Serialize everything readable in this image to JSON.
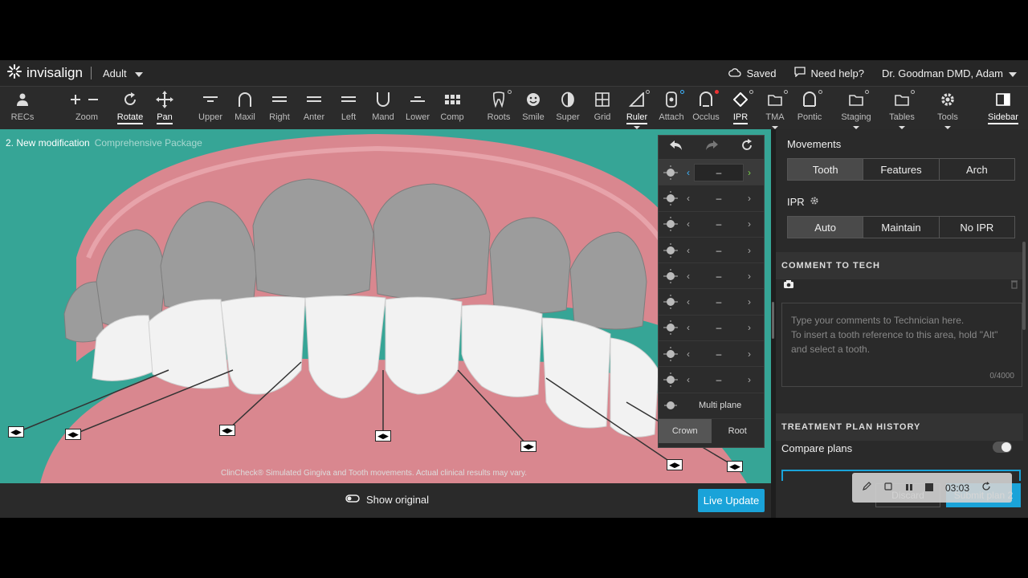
{
  "header": {
    "brand": "invisalign",
    "patient_type": "Adult",
    "saved_label": "Saved",
    "help_label": "Need help?",
    "user": "Dr. Goodman DMD, Adam"
  },
  "toolbar": [
    {
      "label": "RECs",
      "icon": "person-icon"
    },
    {
      "label": "Zoom",
      "icon": "zoom-icon"
    },
    {
      "label": "Rotate",
      "icon": "rotate-icon"
    },
    {
      "label": "Pan",
      "icon": "pan-icon"
    },
    {
      "label": "Upper",
      "icon": "upper-icon"
    },
    {
      "label": "Maxil",
      "icon": "maxil-icon"
    },
    {
      "label": "Right",
      "icon": "right-view-icon"
    },
    {
      "label": "Anter",
      "icon": "anterior-icon"
    },
    {
      "label": "Left",
      "icon": "left-view-icon"
    },
    {
      "label": "Mand",
      "icon": "mand-icon"
    },
    {
      "label": "Lower",
      "icon": "lower-icon"
    },
    {
      "label": "Comp",
      "icon": "comp-icon"
    },
    {
      "label": "Roots",
      "icon": "roots-icon"
    },
    {
      "label": "Smile",
      "icon": "smile-icon"
    },
    {
      "label": "Super",
      "icon": "super-icon"
    },
    {
      "label": "Grid",
      "icon": "grid-icon"
    },
    {
      "label": "Ruler",
      "icon": "ruler-icon"
    },
    {
      "label": "Attach",
      "icon": "attach-icon"
    },
    {
      "label": "Occlus",
      "icon": "occlusion-icon"
    },
    {
      "label": "IPR",
      "icon": "ipr-icon"
    },
    {
      "label": "TMA",
      "icon": "tma-icon"
    },
    {
      "label": "Pontic",
      "icon": "pontic-icon"
    },
    {
      "label": "Staging",
      "icon": "staging-icon"
    },
    {
      "label": "Tables",
      "icon": "tables-icon"
    },
    {
      "label": "Tools",
      "icon": "gear-icon"
    },
    {
      "label": "Sidebar",
      "icon": "sidebar-icon"
    }
  ],
  "viewport": {
    "title": "2. New modification",
    "package": "Comprehensive Package",
    "footnote": "ClinCheck® Simulated Gingiva and Tooth movements. Actual clinical results may vary."
  },
  "movement_panel": {
    "rows": [
      "–",
      "–",
      "–",
      "–",
      "–",
      "–",
      "–",
      "–",
      "–"
    ],
    "multi_plane": "Multi plane",
    "crown": "Crown",
    "root": "Root"
  },
  "bottom": {
    "show_original": "Show original",
    "live_update": "Live Update"
  },
  "sidebar": {
    "movements_title": "Movements",
    "movement_tabs": [
      "Tooth",
      "Features",
      "Arch"
    ],
    "ipr_title": "IPR",
    "ipr_tabs": [
      "Auto",
      "Maintain",
      "No IPR"
    ],
    "comment_heading": "COMMENT TO TECH",
    "comment_placeholder_1": "Type your comments to Technician here.",
    "comment_placeholder_2": "To insert a tooth reference to this area, hold \"Alt\" and select a tooth.",
    "comment_counter": "0/4000",
    "history_heading": "TREATMENT PLAN HISTORY",
    "compare_plans": "Compare plans",
    "discard": "Discard",
    "submit": "Submit plan 2"
  },
  "recorder": {
    "time": "03:03"
  }
}
